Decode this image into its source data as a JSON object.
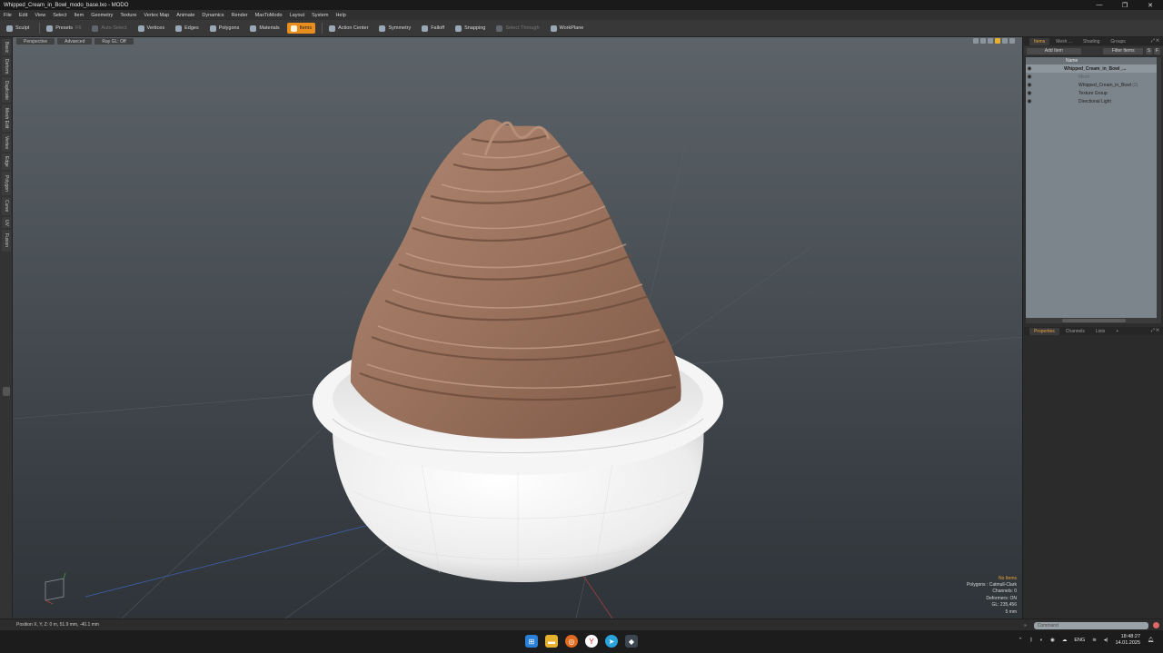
{
  "window": {
    "title": "Whipped_Cream_in_Bowl_modo_base.lxo - MODO",
    "controls": [
      "—",
      "❐",
      "✕"
    ]
  },
  "menu": [
    "File",
    "Edit",
    "View",
    "Select",
    "Item",
    "Geometry",
    "Texture",
    "Vertex Map",
    "Animate",
    "Dynamics",
    "Render",
    "MaxToModo",
    "Layout",
    "System",
    "Help"
  ],
  "toolbar": {
    "sculpt": "Sculpt",
    "presets": "Presets",
    "presets_key": "F6",
    "auto_select": "Auto Select",
    "vertices": "Vertices",
    "edges": "Edges",
    "polygons": "Polygons",
    "materials": "Materials",
    "items": "Items",
    "action_center": "Action Center",
    "symmetry": "Symmetry",
    "falloff": "Falloff",
    "snapping": "Snapping",
    "select_through": "Select Through",
    "workplane": "WorkPlane"
  },
  "left_tabs": [
    "Basic",
    "Deform",
    "Duplicate",
    "Mesh Edit",
    "Vertex",
    "Edge",
    "Polygon",
    "Curve",
    "UV",
    "Fusion"
  ],
  "viewport": {
    "tabs": [
      "Perspective",
      "Advanced",
      "Ray GL: Off"
    ],
    "stats": {
      "selection": "No Items",
      "polygons": "Polygons : Catmull-Clark",
      "channels": "Channels: 0",
      "deformers": "Deformers: ON",
      "gl": "GL: 235,456",
      "distance": "5 mm"
    },
    "colors": {
      "cream": "#9c7560",
      "bowl": "#f2f2f2",
      "accent": "#e88e1e"
    }
  },
  "items_panel": {
    "tabs": [
      "Items",
      "Mesh ...",
      "Shading",
      "Groups"
    ],
    "add_item": "Add Item",
    "filter_items": "Filter Items",
    "column_name": "Name",
    "rows": [
      {
        "label": "Whipped_Cream_in_Bowl_...",
        "bold": true
      },
      {
        "label": "Mesh",
        "gray": true
      },
      {
        "label": "Whipped_Cream_in_Bowl",
        "suffix": "(2)"
      },
      {
        "label": "Texture Group"
      },
      {
        "label": "Directional Light"
      }
    ]
  },
  "properties_panel": {
    "tabs": [
      "Properties",
      "Channels",
      "Lists",
      "+"
    ]
  },
  "status": {
    "position": "Position X, Y, Z:   0 m, 51.9 mm, -40.1 mm",
    "command_placeholder": "Command"
  },
  "taskbar": {
    "lang": "ENG",
    "time": "18:48:27",
    "date": "14.01.2025"
  }
}
